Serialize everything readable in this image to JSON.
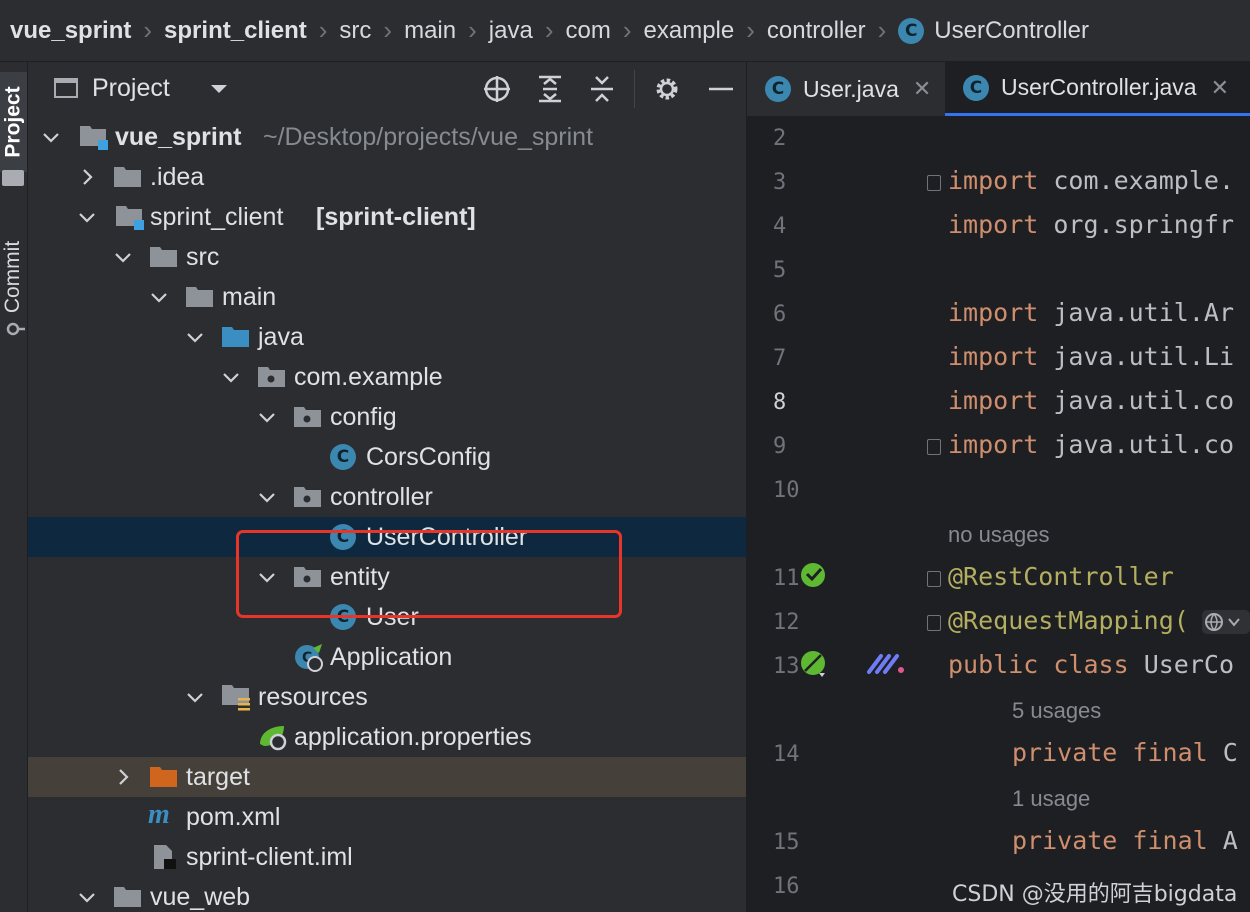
{
  "breadcrumb": [
    "vue_sprint",
    "sprint_client",
    "src",
    "main",
    "java",
    "com",
    "example",
    "controller",
    "UserController"
  ],
  "tool_stripe": {
    "project": "Project",
    "commit": "Commit"
  },
  "project_panel": {
    "title": "Project"
  },
  "tree": {
    "root": {
      "label": "vue_sprint",
      "path": "~/Desktop/projects/vue_sprint"
    },
    "idea": ".idea",
    "module": {
      "label": "sprint_client",
      "suffix": "[sprint-client]"
    },
    "src": "src",
    "main": "main",
    "java": "java",
    "package": "com.example",
    "config": "config",
    "cors": "CorsConfig",
    "controller": "controller",
    "user_controller": "UserController",
    "entity": "entity",
    "user": "User",
    "application": "Application",
    "resources": "resources",
    "app_props": "application.properties",
    "target": "target",
    "pom": "pom.xml",
    "iml": "sprint-client.iml",
    "vue_web": "vue_web"
  },
  "tabs": [
    {
      "label": "User.java"
    },
    {
      "label": "UserController.java"
    }
  ],
  "class_icon_letter": "C",
  "editor": {
    "line_numbers": [
      "2",
      "3",
      "4",
      "5",
      "6",
      "7",
      "8",
      "9",
      "10",
      "11",
      "12",
      "13",
      "14",
      "15",
      "16"
    ],
    "import_kw": "import",
    "lines": {
      "l3": "com.example.",
      "l4": "org.springfr",
      "l6": "java.util.Ar",
      "l7": "java.util.Li",
      "l8": "java.util.co",
      "l9": "java.util.co",
      "l11": "@RestController",
      "l12": "@RequestMapping(",
      "l13_kw": "public class",
      "l13": "UserCo",
      "l14_kw": "private final",
      "l14": "C",
      "l15_kw": "private final",
      "l15": "A"
    },
    "hints": {
      "no_usages": "no usages",
      "five_usages": "5 usages",
      "one_usage": "1 usage"
    }
  },
  "watermark": "CSDN @没用的阿吉bigdata",
  "colors": {
    "selection": "#0e293f",
    "highlight_box": "#e8352a",
    "keyword": "#cf8e6d",
    "annotation": "#b3ae60",
    "class_icon": "#3c87b0"
  }
}
